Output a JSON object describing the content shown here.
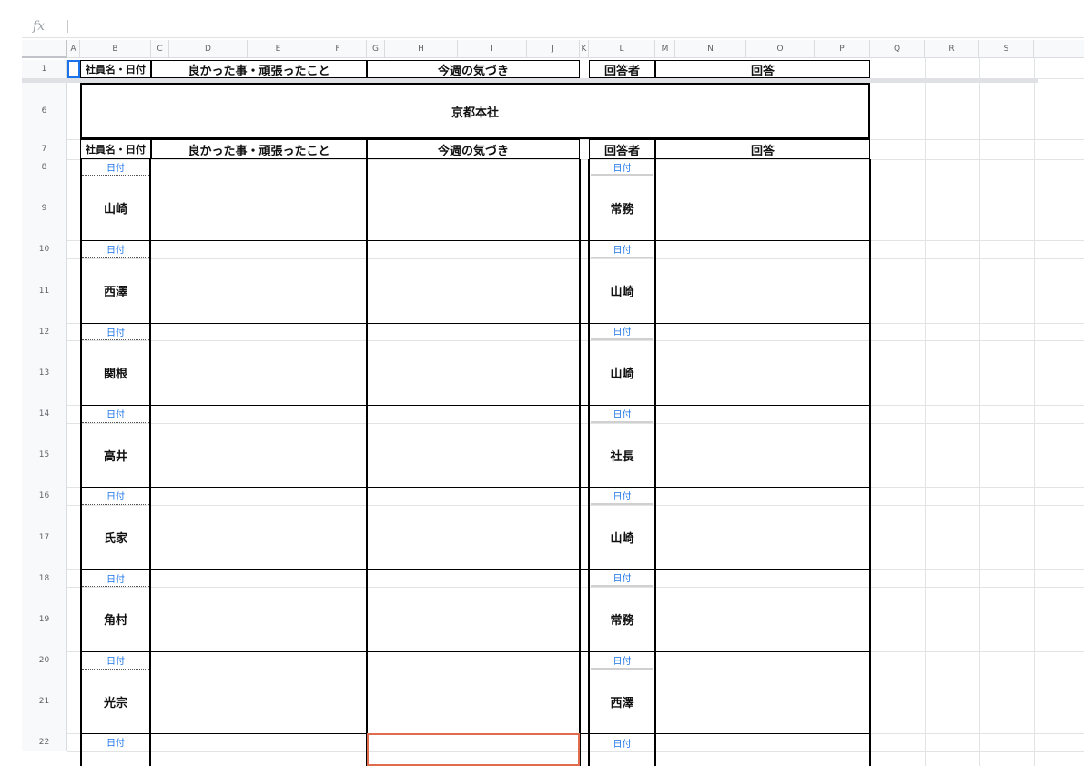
{
  "formula_bar": {
    "label": "fx"
  },
  "columns": [
    "A",
    "B",
    "C",
    "D",
    "E",
    "F",
    "G",
    "H",
    "I",
    "J",
    "K",
    "L",
    "M",
    "N",
    "O",
    "P",
    "Q",
    "R",
    "S"
  ],
  "rows": [
    "1",
    "6",
    "7",
    "8",
    "9",
    "10",
    "11",
    "12",
    "13",
    "14",
    "15",
    "16",
    "17",
    "18",
    "19",
    "20",
    "21",
    "22"
  ],
  "headers": {
    "name_date": "社員名・日付",
    "good": "良かった事・頑張ったこと",
    "insight": "今週の気づき",
    "responder": "回答者",
    "answer": "回答"
  },
  "office": "京都本社",
  "date_label": "日付",
  "entries": [
    {
      "name": "山崎",
      "responder": "常務"
    },
    {
      "name": "西澤",
      "responder": "山崎"
    },
    {
      "name": "関根",
      "responder": "山崎"
    },
    {
      "name": "高井",
      "responder": "社長"
    },
    {
      "name": "氏家",
      "responder": "山崎"
    },
    {
      "name": "角村",
      "responder": "常務"
    },
    {
      "name": "光宗",
      "responder": "西澤"
    }
  ]
}
